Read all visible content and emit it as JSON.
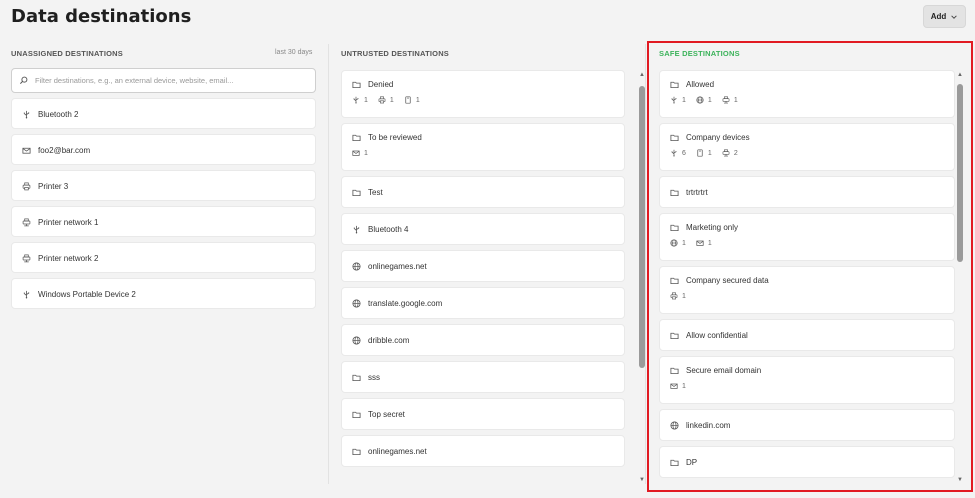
{
  "page": {
    "title": "Data destinations"
  },
  "header": {
    "add_label": "Add"
  },
  "unassigned": {
    "heading": "UNASSIGNED DESTINATIONS",
    "note": "last 30 days",
    "search_placeholder": "Filter destinations, e.g., an external device, website, email...",
    "items": [
      {
        "label": "Bluetooth 2",
        "icon": "usb-icon"
      },
      {
        "label": "foo2@bar.com",
        "icon": "mail-icon"
      },
      {
        "label": "Printer 3",
        "icon": "printer-icon"
      },
      {
        "label": "Printer network 1",
        "icon": "network-printer-icon"
      },
      {
        "label": "Printer network 2",
        "icon": "network-printer-icon"
      },
      {
        "label": "Windows Portable Device 2",
        "icon": "usb-icon"
      }
    ]
  },
  "untrusted": {
    "heading": "UNTRUSTED DESTINATIONS",
    "items": [
      {
        "label": "Denied",
        "icon": "folder-icon",
        "meta": [
          {
            "icon": "usb-icon",
            "count": "1"
          },
          {
            "icon": "printer-icon",
            "count": "1"
          },
          {
            "icon": "device-icon",
            "count": "1"
          }
        ]
      },
      {
        "label": "To be reviewed",
        "icon": "folder-icon",
        "meta": [
          {
            "icon": "mail-icon",
            "count": "1"
          }
        ]
      },
      {
        "label": "Test",
        "icon": "folder-icon"
      },
      {
        "label": "Bluetooth 4",
        "icon": "usb-icon"
      },
      {
        "label": "onlinegames.net",
        "icon": "globe-icon"
      },
      {
        "label": "translate.google.com",
        "icon": "globe-icon"
      },
      {
        "label": "dribble.com",
        "icon": "globe-icon"
      },
      {
        "label": "sss",
        "icon": "folder-icon"
      },
      {
        "label": "Top secret",
        "icon": "folder-icon"
      },
      {
        "label": "onlinegames.net",
        "icon": "folder-icon"
      }
    ]
  },
  "safe": {
    "heading": "SAFE DESTINATIONS",
    "heading_color": "#3cb35b",
    "items": [
      {
        "label": "Allowed",
        "icon": "folder-icon",
        "meta": [
          {
            "icon": "usb-icon",
            "count": "1"
          },
          {
            "icon": "globe-icon",
            "count": "1"
          },
          {
            "icon": "network-printer-icon",
            "count": "1"
          }
        ]
      },
      {
        "label": "Company devices",
        "icon": "folder-icon",
        "meta": [
          {
            "icon": "usb-icon",
            "count": "6"
          },
          {
            "icon": "device-icon",
            "count": "1"
          },
          {
            "icon": "network-printer-icon",
            "count": "2"
          }
        ]
      },
      {
        "label": "trtrtrtrt",
        "icon": "folder-icon"
      },
      {
        "label": "Marketing only",
        "icon": "folder-icon",
        "meta": [
          {
            "icon": "globe-icon",
            "count": "1"
          },
          {
            "icon": "mail-icon",
            "count": "1"
          }
        ]
      },
      {
        "label": "Company secured data",
        "icon": "folder-icon",
        "meta": [
          {
            "icon": "printer-icon",
            "count": "1"
          }
        ]
      },
      {
        "label": "Allow confidential",
        "icon": "folder-icon"
      },
      {
        "label": "Secure email domain",
        "icon": "folder-icon",
        "meta": [
          {
            "icon": "mail-icon",
            "count": "1"
          }
        ]
      },
      {
        "label": "linkedin.com",
        "icon": "globe-icon"
      },
      {
        "label": "DP",
        "icon": "folder-icon"
      }
    ]
  },
  "colors": {
    "highlight_border": "#e11a22",
    "safe_heading": "#3cb35b"
  }
}
